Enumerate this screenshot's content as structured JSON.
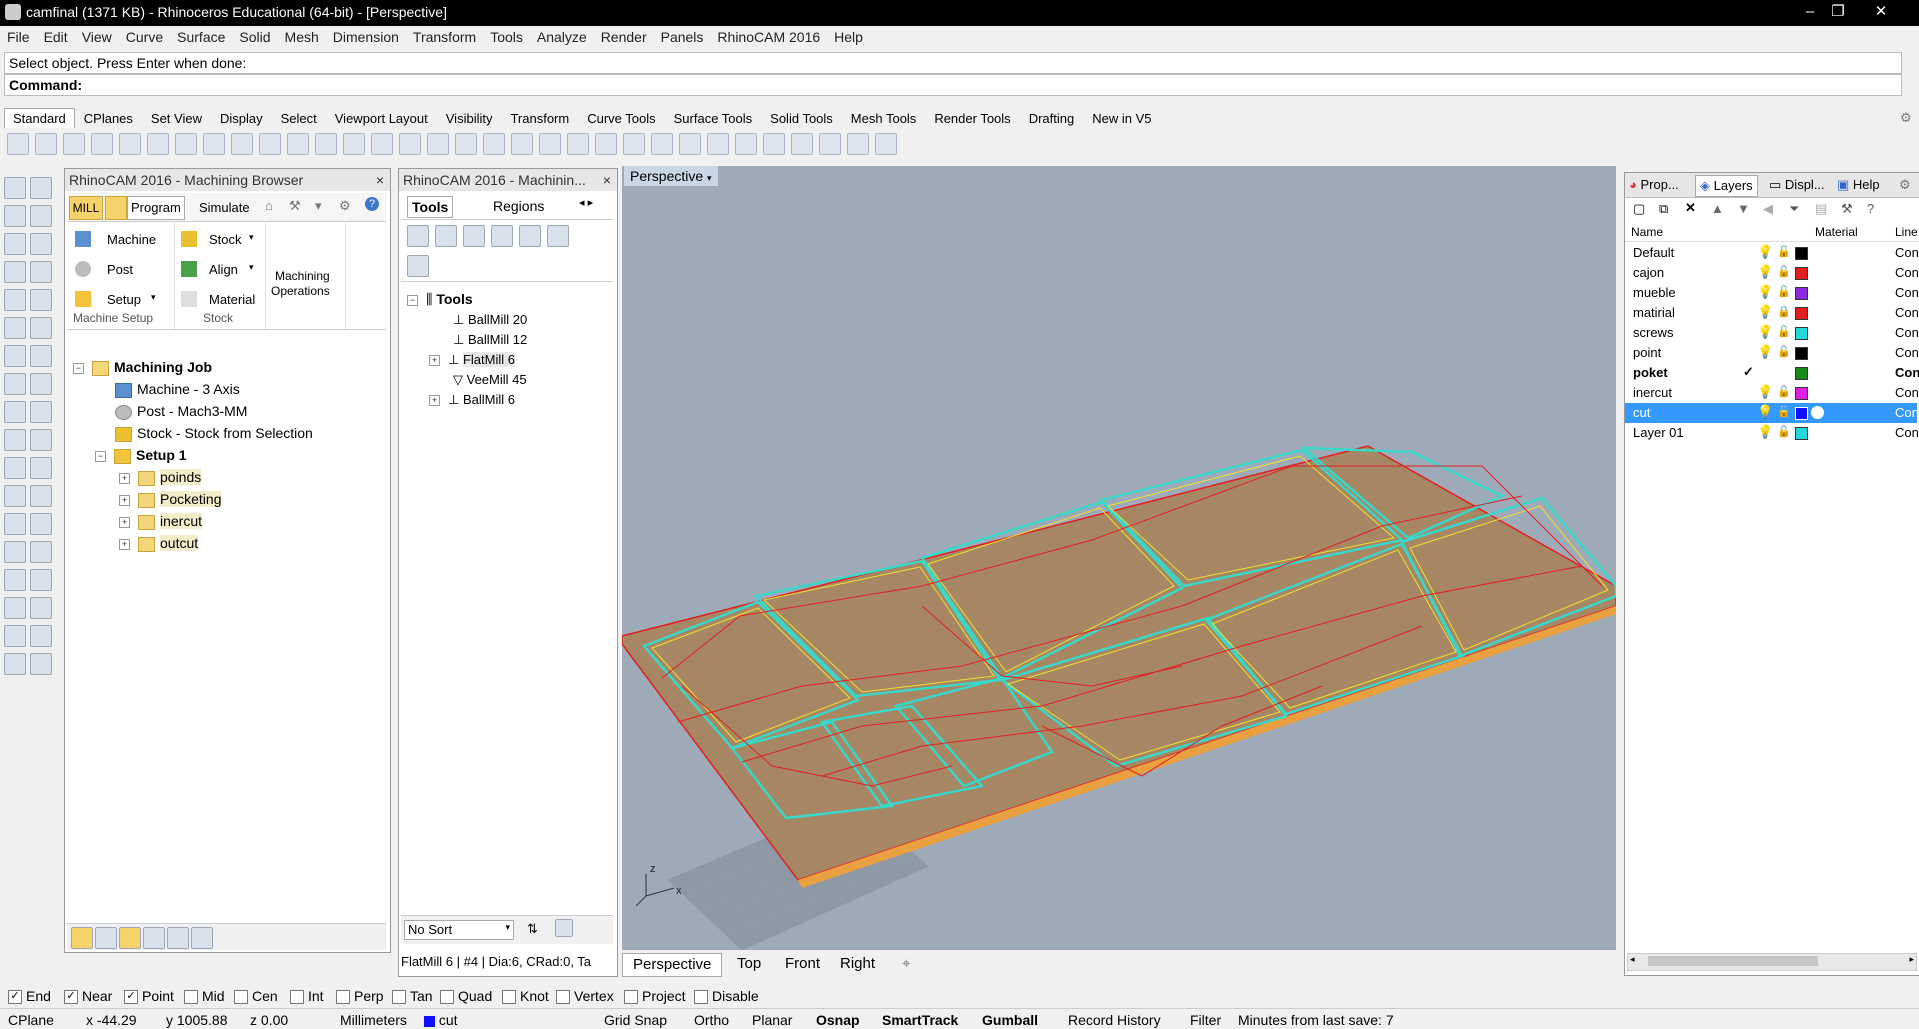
{
  "window": {
    "title": "camfinal (1371 KB) - Rhinoceros Educational (64-bit) - [Perspective]"
  },
  "menu": [
    "File",
    "Edit",
    "View",
    "Curve",
    "Surface",
    "Solid",
    "Mesh",
    "Dimension",
    "Transform",
    "Tools",
    "Analyze",
    "Render",
    "Panels",
    "RhinoCAM 2016",
    "Help"
  ],
  "command": {
    "prompt": "Select object. Press Enter when done:",
    "label": "Command:"
  },
  "toolbar_tabs": [
    "Standard",
    "CPlanes",
    "Set View",
    "Display",
    "Select",
    "Viewport Layout",
    "Visibility",
    "Transform",
    "Curve Tools",
    "Surface Tools",
    "Solid Tools",
    "Mesh Tools",
    "Render Tools",
    "Drafting",
    "New in V5"
  ],
  "browser": {
    "title": "RhinoCAM 2016 - Machining Browser",
    "mode_tabs": [
      "MILL",
      "Program",
      "Simulate"
    ],
    "groups": {
      "machine_setup": {
        "label": "Machine Setup",
        "items": [
          "Machine",
          "Post",
          "Setup"
        ]
      },
      "stock": {
        "label": "Stock",
        "items": [
          "Stock",
          "Align",
          "Material"
        ]
      },
      "ops_label_1": "Machining",
      "ops_label_2": "Operations"
    },
    "tree": {
      "root": "Machining Job",
      "machine": "Machine - 3 Axis",
      "post": "Post - Mach3-MM",
      "stock": "Stock - Stock from Selection",
      "setup": "Setup 1",
      "folders": [
        "poinds",
        "Pocketing",
        "inercut",
        "outcut"
      ]
    }
  },
  "tools_panel": {
    "title": "RhinoCAM 2016 - Machinin...",
    "tabs": [
      "Tools",
      "Regions"
    ],
    "root": "Tools",
    "items": [
      "BallMill 20",
      "BallMill 12",
      "FlatMill 6",
      "VeeMill 45",
      "BallMill 6"
    ],
    "sort": "No Sort",
    "status": "FlatMill 6 | #4 | Dia:6, CRad:0, Ta"
  },
  "viewport": {
    "label": "Perspective",
    "tabs": [
      "Perspective",
      "Top",
      "Front",
      "Right"
    ],
    "axis_x": "x",
    "axis_z": "z"
  },
  "layers_panel": {
    "tabs": [
      "Prop...",
      "Layers",
      "Displ...",
      "Help"
    ],
    "columns": [
      "Name",
      "Material",
      "Line"
    ],
    "rows": [
      {
        "name": "Default",
        "color": "#000000",
        "line": "Cont"
      },
      {
        "name": "cajon",
        "color": "#e02020",
        "line": "Cont"
      },
      {
        "name": "mueble",
        "color": "#8a2be2",
        "line": "Cont"
      },
      {
        "name": "matirial",
        "color": "#e02020",
        "line": "Cont"
      },
      {
        "name": "screws",
        "color": "#20d8d8",
        "line": "Cont"
      },
      {
        "name": "point",
        "color": "#000000",
        "line": "Cont"
      },
      {
        "name": "poket",
        "color": "#1a8a1a",
        "line": "Cont"
      },
      {
        "name": "inercut",
        "color": "#e020e0",
        "line": "Cont"
      },
      {
        "name": "cut",
        "color": "#1010ff",
        "line": "Cont"
      },
      {
        "name": "Layer 01",
        "color": "#20d8d8",
        "line": "Cont"
      }
    ],
    "current_mark": "✓"
  },
  "osnaps": [
    {
      "label": "End",
      "checked": true
    },
    {
      "label": "Near",
      "checked": true
    },
    {
      "label": "Point",
      "checked": true
    },
    {
      "label": "Mid",
      "checked": false
    },
    {
      "label": "Cen",
      "checked": false
    },
    {
      "label": "Int",
      "checked": false
    },
    {
      "label": "Perp",
      "checked": false
    },
    {
      "label": "Tan",
      "checked": false
    },
    {
      "label": "Quad",
      "checked": false
    },
    {
      "label": "Knot",
      "checked": false
    },
    {
      "label": "Vertex",
      "checked": false
    },
    {
      "label": "Project",
      "checked": false
    },
    {
      "label": "Disable",
      "checked": false
    }
  ],
  "status": {
    "cplane": "CPlane",
    "x": "x -44.29",
    "y": "y 1005.88",
    "z": "z 0.00",
    "units": "Millimeters",
    "layer": "cut",
    "layer_color": "#1010ff",
    "toggles": [
      "Grid Snap",
      "Ortho",
      "Planar",
      "Osnap",
      "SmartTrack",
      "Gumball",
      "Record History",
      "Filter"
    ],
    "save_info": "Minutes from last save: 7"
  }
}
